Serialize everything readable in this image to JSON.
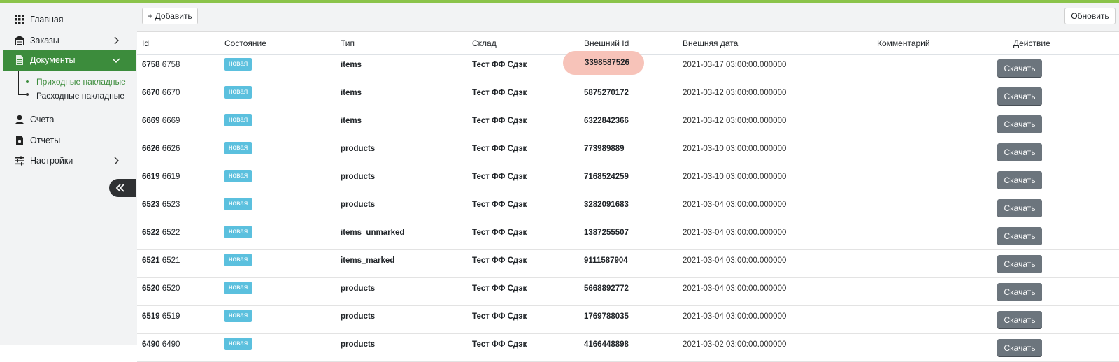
{
  "colors": {
    "topbar": "#8bc34a",
    "nav_active": "#3c8c3c",
    "submenu_active_text": "#3c8c3c",
    "badge": "#5bc0de",
    "download_button": "#6c757d",
    "highlight": "#f7c3b9"
  },
  "sidebar": {
    "items": [
      {
        "label": "Главная",
        "icon": "grid-icon"
      },
      {
        "label": "Заказы",
        "icon": "warehouse-icon",
        "has_chevron": true
      },
      {
        "label": "Документы",
        "icon": "document-icon",
        "has_chevron": true,
        "active": true
      },
      {
        "label": "Счета",
        "icon": "user-icon"
      },
      {
        "label": "Отчеты",
        "icon": "file-icon"
      },
      {
        "label": "Настройки",
        "icon": "sliders-icon",
        "has_chevron": true
      }
    ],
    "submenu": [
      {
        "label": "Приходные накладные",
        "active": true
      },
      {
        "label": "Расходные накладные",
        "active": false
      }
    ],
    "collapse_icon": "double-chevron-left-icon"
  },
  "toolbar": {
    "add_label": "+ Добавить",
    "refresh_label": "Обновить"
  },
  "table": {
    "columns": [
      "Id",
      "Состояние",
      "Тип",
      "Склад",
      "Внешний Id",
      "Внешняя дата",
      "Комментарий",
      "Действие"
    ],
    "rows": [
      {
        "id_bold": "6758",
        "id": "6758",
        "status": "новая",
        "type": "items",
        "warehouse": "Тест ФФ Сдэк",
        "ext_id": "3398587526",
        "ext_date": "2021-03-17 03:00:00.000000",
        "comment": "",
        "action": "Скачать"
      },
      {
        "id_bold": "6670",
        "id": "6670",
        "status": "новая",
        "type": "items",
        "warehouse": "Тест ФФ Сдэк",
        "ext_id": "5875270172",
        "ext_date": "2021-03-12 03:00:00.000000",
        "comment": "",
        "action": "Скачать"
      },
      {
        "id_bold": "6669",
        "id": "6669",
        "status": "новая",
        "type": "items",
        "warehouse": "Тест ФФ Сдэк",
        "ext_id": "6322842366",
        "ext_date": "2021-03-12 03:00:00.000000",
        "comment": "",
        "action": "Скачать"
      },
      {
        "id_bold": "6626",
        "id": "6626",
        "status": "новая",
        "type": "products",
        "warehouse": "Тест ФФ Сдэк",
        "ext_id": "773989889",
        "ext_date": "2021-03-10 03:00:00.000000",
        "comment": "",
        "action": "Скачать"
      },
      {
        "id_bold": "6619",
        "id": "6619",
        "status": "новая",
        "type": "products",
        "warehouse": "Тест ФФ Сдэк",
        "ext_id": "7168524259",
        "ext_date": "2021-03-10 03:00:00.000000",
        "comment": "",
        "action": "Скачать"
      },
      {
        "id_bold": "6523",
        "id": "6523",
        "status": "новая",
        "type": "products",
        "warehouse": "Тест ФФ Сдэк",
        "ext_id": "3282091683",
        "ext_date": "2021-03-04 03:00:00.000000",
        "comment": "",
        "action": "Скачать"
      },
      {
        "id_bold": "6522",
        "id": "6522",
        "status": "новая",
        "type": "items_unmarked",
        "warehouse": "Тест ФФ Сдэк",
        "ext_id": "1387255507",
        "ext_date": "2021-03-04 03:00:00.000000",
        "comment": "",
        "action": "Скачать"
      },
      {
        "id_bold": "6521",
        "id": "6521",
        "status": "новая",
        "type": "items_marked",
        "warehouse": "Тест ФФ Сдэк",
        "ext_id": "9111587904",
        "ext_date": "2021-03-04 03:00:00.000000",
        "comment": "",
        "action": "Скачать"
      },
      {
        "id_bold": "6520",
        "id": "6520",
        "status": "новая",
        "type": "products",
        "warehouse": "Тест ФФ Сдэк",
        "ext_id": "5668892772",
        "ext_date": "2021-03-04 03:00:00.000000",
        "comment": "",
        "action": "Скачать"
      },
      {
        "id_bold": "6519",
        "id": "6519",
        "status": "новая",
        "type": "products",
        "warehouse": "Тест ФФ Сдэк",
        "ext_id": "1769788035",
        "ext_date": "2021-03-04 03:00:00.000000",
        "comment": "",
        "action": "Скачать"
      },
      {
        "id_bold": "6490",
        "id": "6490",
        "status": "новая",
        "type": "products",
        "warehouse": "Тест ФФ Сдэк",
        "ext_id": "4166448898",
        "ext_date": "2021-03-02 03:00:00.000000",
        "comment": "",
        "action": "Скачать"
      }
    ]
  }
}
